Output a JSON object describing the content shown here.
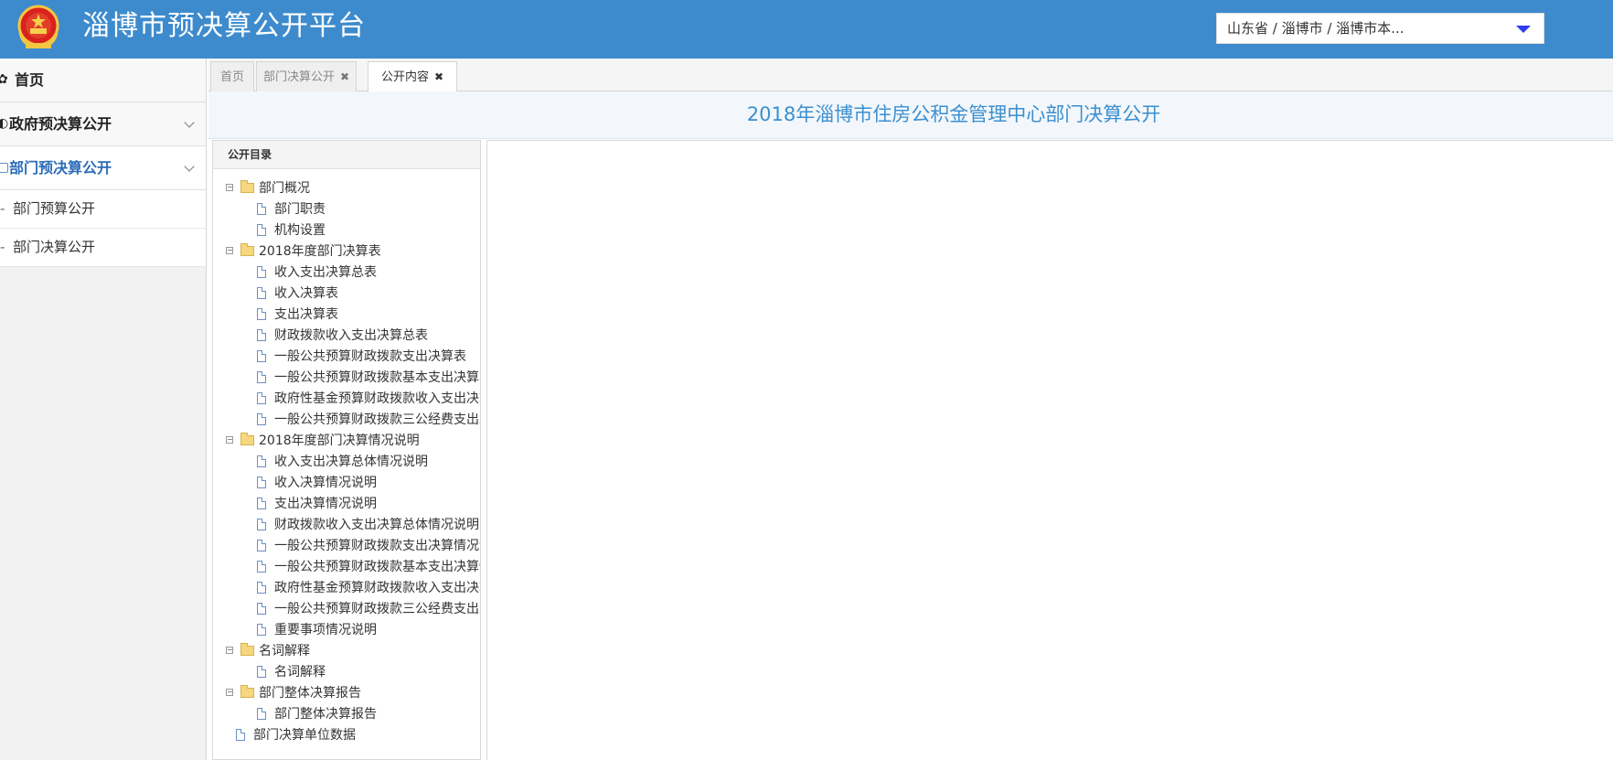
{
  "header": {
    "title": "淄博市预决算公开平台",
    "emblem_icon": "national-emblem",
    "region_select": {
      "value": "山东省 / 淄博市 / 淄博市本..."
    }
  },
  "sidebar": {
    "items": [
      {
        "label": "首页",
        "icon": "home-icon"
      },
      {
        "label": "政府预决算公开",
        "icon": "globe-icon"
      },
      {
        "label": "部门预决算公开",
        "icon": "document-icon",
        "active": true
      }
    ],
    "sub_items": [
      "部门预算公开",
      "部门决算公开"
    ]
  },
  "tabs": [
    {
      "label": "首页"
    },
    {
      "label": "部门决算公开"
    },
    {
      "label": "公开内容",
      "active": true
    }
  ],
  "content": {
    "title": "2018年淄博市住房公积金管理中心部门决算公开"
  },
  "tree": {
    "header": "公开目录",
    "nodes": [
      {
        "label": "部门概况",
        "type": "folder"
      },
      {
        "label": "部门职责",
        "type": "doc"
      },
      {
        "label": "机构设置",
        "type": "doc"
      },
      {
        "label": "2018年度部门决算表",
        "type": "folder"
      },
      {
        "label": "收入支出决算总表",
        "type": "doc"
      },
      {
        "label": "收入决算表",
        "type": "doc"
      },
      {
        "label": "支出决算表",
        "type": "doc"
      },
      {
        "label": "财政拨款收入支出决算总表",
        "type": "doc"
      },
      {
        "label": "一般公共预算财政拨款支出决算表",
        "type": "doc"
      },
      {
        "label": "一般公共预算财政拨款基本支出决算表",
        "type": "doc"
      },
      {
        "label": "政府性基金预算财政拨款收入支出决算表",
        "type": "doc"
      },
      {
        "label": "一般公共预算财政拨款三公经费支出决算表",
        "type": "doc"
      },
      {
        "label": "2018年度部门决算情况说明",
        "type": "folder"
      },
      {
        "label": "收入支出决算总体情况说明",
        "type": "doc"
      },
      {
        "label": "收入决算情况说明",
        "type": "doc"
      },
      {
        "label": "支出决算情况说明",
        "type": "doc"
      },
      {
        "label": "财政拨款收入支出决算总体情况说明",
        "type": "doc"
      },
      {
        "label": "一般公共预算财政拨款支出决算情况说明",
        "type": "doc"
      },
      {
        "label": "一般公共预算财政拨款基本支出决算情况说明",
        "type": "doc"
      },
      {
        "label": "政府性基金预算财政拨款收入支出决算情况说明",
        "type": "doc"
      },
      {
        "label": "一般公共预算财政拨款三公经费支出决算情况说明",
        "type": "doc"
      },
      {
        "label": "重要事项情况说明",
        "type": "doc"
      },
      {
        "label": "名词解释",
        "type": "folder"
      },
      {
        "label": "名词解释",
        "type": "doc"
      },
      {
        "label": "部门整体决算报告",
        "type": "folder"
      },
      {
        "label": "部门整体决算报告",
        "type": "doc"
      },
      {
        "label": "部门决算单位数据",
        "type": "doc-root"
      }
    ]
  }
}
